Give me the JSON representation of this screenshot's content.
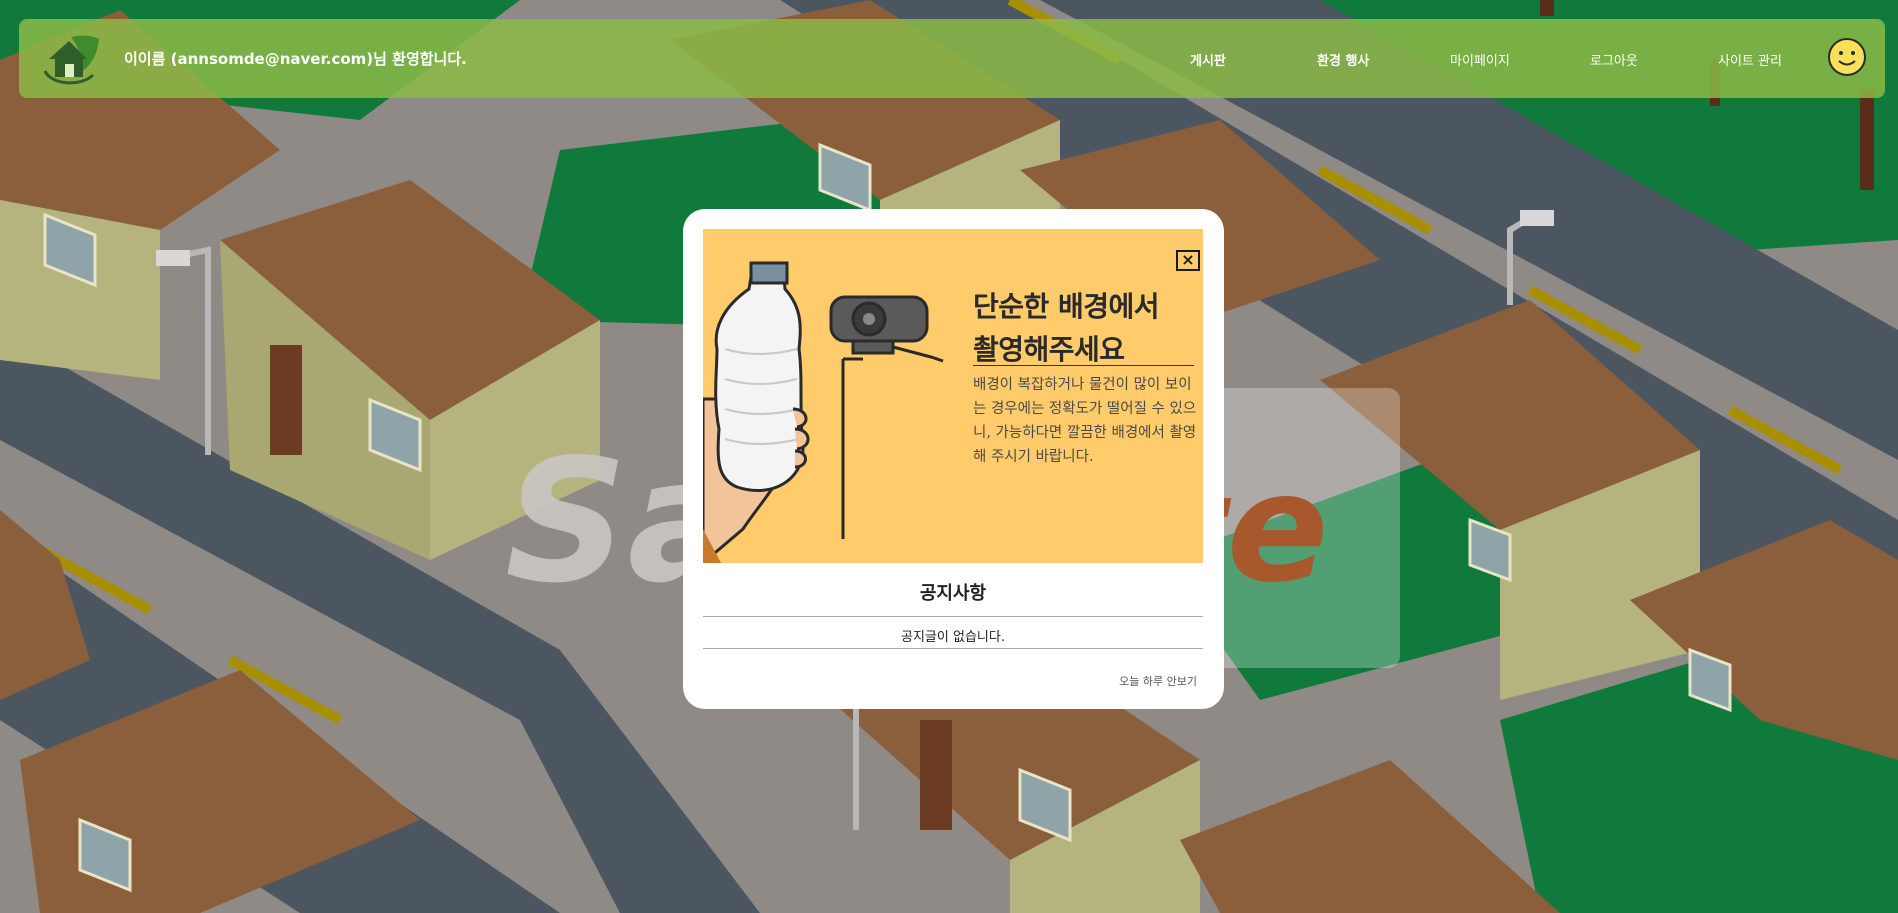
{
  "header": {
    "welcome": "이이름 (annsomde@naver.com)님 환영합니다.",
    "nav": {
      "board": "게시판",
      "eco_events": "환경 행사",
      "mypage": "마이페이지",
      "logout": "로그아웃",
      "site_admin": "사이트 관리"
    }
  },
  "background": {
    "watermark_left": "Sa",
    "watermark_right": "te"
  },
  "modal": {
    "close_label": "×",
    "banner_title_line1": "단순한 배경에서",
    "banner_title_line2": "촬영해주세요",
    "banner_desc": "배경이 복잡하거나 물건이 많이 보이는 경우에는 정확도가 떨어질 수 있으니, 가능하다면 깔끔한 배경에서 촬영해 주시기 바랍니다.",
    "notice_title": "공지사항",
    "notice_empty": "공지글이 없습니다.",
    "hide_today": "오늘 하루 안보기"
  },
  "colors": {
    "header_bg": "#8bba47",
    "banner_bg": "#ffcb6b",
    "grass": "#0f7a3c",
    "road": "#4b5660",
    "roof": "#8b5e3c",
    "wall": "#b5b47e"
  },
  "icons": [
    "home-leaf-logo-icon",
    "smiley-avatar-icon",
    "close-icon",
    "water-bottle-illustration",
    "webcam-illustration"
  ]
}
